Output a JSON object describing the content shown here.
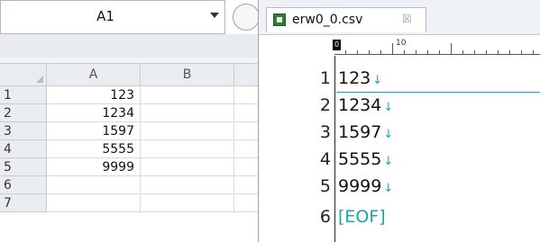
{
  "spreadsheet": {
    "name_box": "A1",
    "columns": [
      "A",
      "B"
    ],
    "rows": [
      {
        "num": "1",
        "a": "123"
      },
      {
        "num": "2",
        "a": "1234"
      },
      {
        "num": "3",
        "a": "1597"
      },
      {
        "num": "4",
        "a": "5555"
      },
      {
        "num": "5",
        "a": "9999"
      },
      {
        "num": "6",
        "a": ""
      },
      {
        "num": "7",
        "a": ""
      }
    ]
  },
  "editor": {
    "tab_title": "erw0_0.csv",
    "tab_close": "☒",
    "ruler_zero": "0",
    "ruler_ten": "10",
    "newline_glyph": "↓",
    "lines": [
      {
        "num": "1",
        "text": "123"
      },
      {
        "num": "2",
        "text": "1234"
      },
      {
        "num": "3",
        "text": "1597"
      },
      {
        "num": "4",
        "text": "5555"
      },
      {
        "num": "5",
        "text": "9999"
      },
      {
        "num": "6",
        "text": "[EOF]"
      }
    ]
  },
  "colors": {
    "accent": "#1aa3b5",
    "header_bg": "#e9edf2",
    "grid_line": "#d8dadd"
  },
  "icons": {
    "csv_file": "csv-file-icon",
    "close": "close-icon",
    "dropdown": "chevron-down-icon"
  }
}
